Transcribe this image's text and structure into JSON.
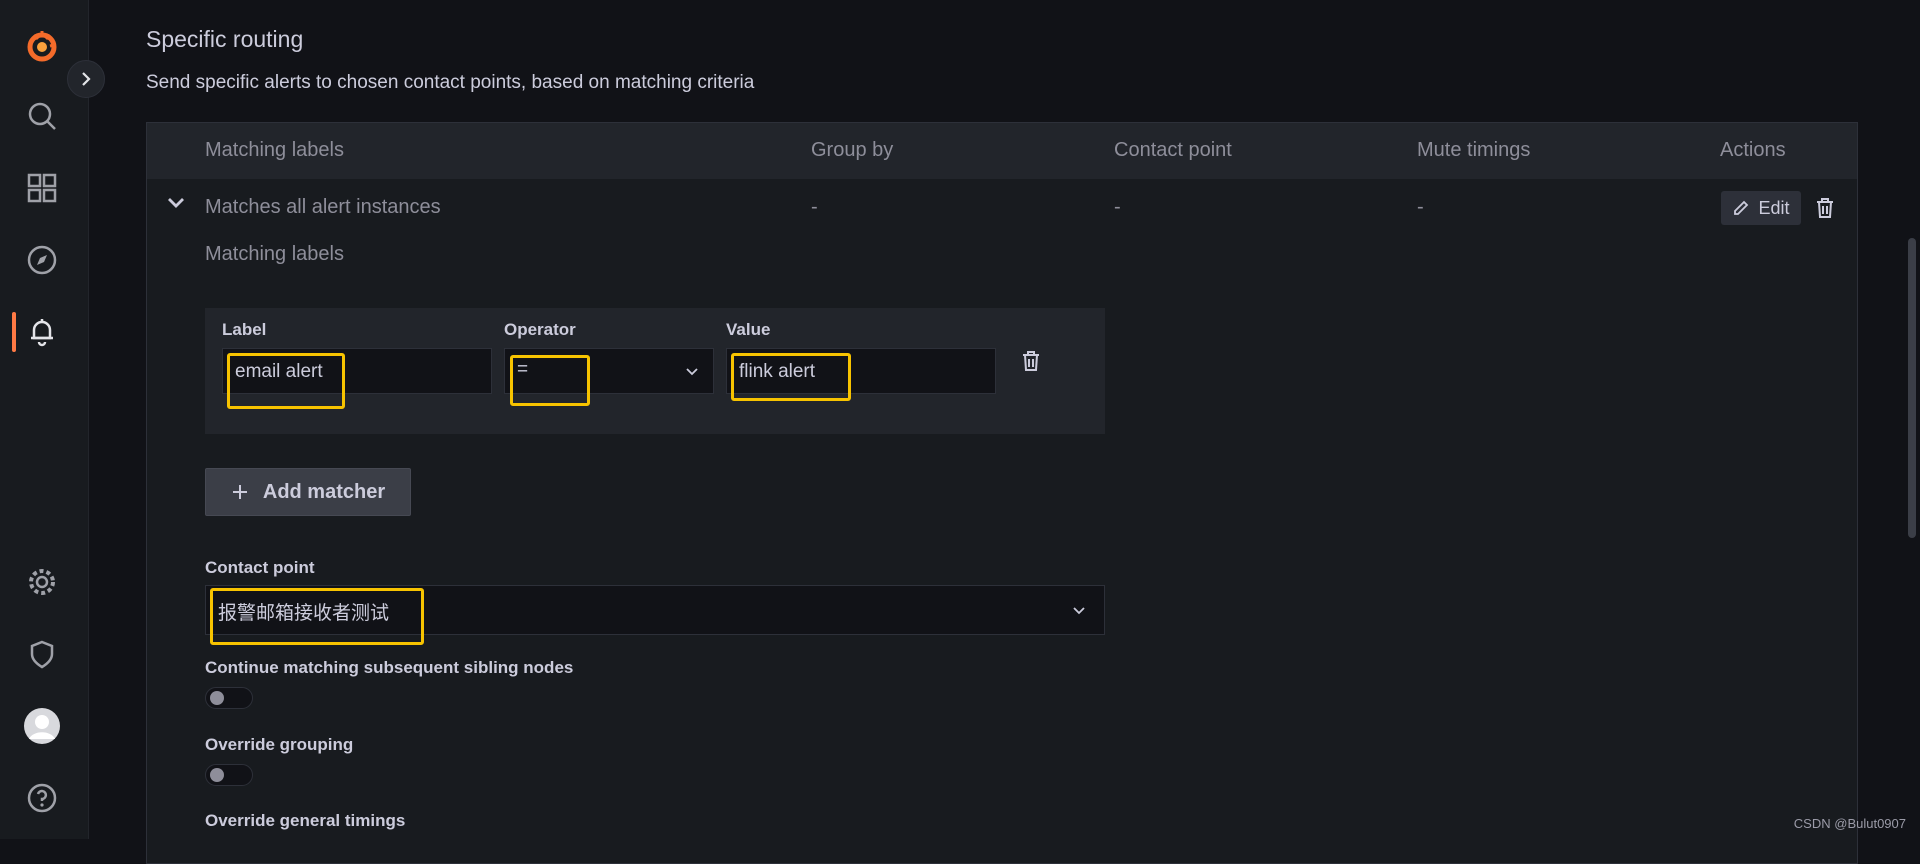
{
  "section": {
    "title": "Specific routing",
    "description": "Send specific alerts to chosen contact points, based on matching criteria"
  },
  "table": {
    "headers": [
      "Matching labels",
      "Group by",
      "Contact point",
      "Mute timings",
      "Actions"
    ],
    "row": {
      "matching": "Matches all alert instances",
      "group_by": "-",
      "contact_point": "-",
      "mute_timings": "-",
      "edit_label": "Edit"
    }
  },
  "matchers": {
    "heading": "Matching labels",
    "label_title": "Label",
    "operator_title": "Operator",
    "value_title": "Value",
    "label_value": "email alert",
    "operator_value": "=",
    "value_value": "flink alert",
    "add_label": "Add matcher"
  },
  "contact": {
    "title": "Contact point",
    "value": "报警邮箱接收者测试"
  },
  "toggles": {
    "continue_label": "Continue matching subsequent sibling nodes",
    "override_grouping_label": "Override grouping",
    "override_timings_label": "Override general timings",
    "continue": false,
    "override_grouping": false
  },
  "watermark": "CSDN @Bulut0907",
  "colors": {
    "accent": "#ff7a45",
    "highlight": "#f7c300",
    "background": "#111217"
  },
  "icons": [
    "grafana-logo-icon",
    "search-icon",
    "dashboards-icon",
    "explore-icon",
    "alerting-icon",
    "settings-icon",
    "shield-icon",
    "user-avatar-icon",
    "help-icon"
  ]
}
